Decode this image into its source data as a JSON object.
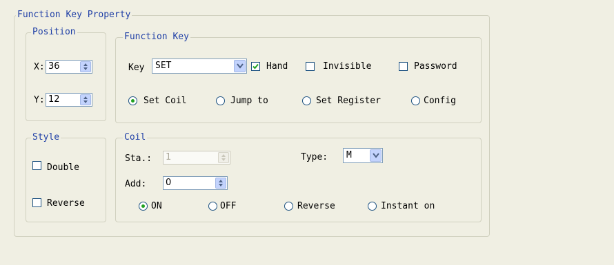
{
  "main_group": {
    "title": "Function Key Property"
  },
  "position": {
    "title": "Position",
    "x_label": "X:",
    "x_value": "36",
    "y_label": "Y:",
    "y_value": "12"
  },
  "function_key": {
    "title": "Function Key",
    "key_label": "Key",
    "key_value": "SET",
    "hand_label": "Hand",
    "hand_checked": true,
    "invisible_label": "Invisible",
    "invisible_checked": false,
    "password_label": "Password",
    "password_checked": false,
    "modes": [
      {
        "label": "Set Coil",
        "selected": true
      },
      {
        "label": "Jump to",
        "selected": false
      },
      {
        "label": "Set Register",
        "selected": false
      },
      {
        "label": "Config",
        "selected": false
      }
    ]
  },
  "style": {
    "title": "Style",
    "double_label": "Double",
    "double_checked": false,
    "reverse_label": "Reverse",
    "reverse_checked": false
  },
  "coil": {
    "title": "Coil",
    "sta_label": "Sta.:",
    "sta_value": "1",
    "type_label": "Type:",
    "type_value": "M",
    "add_label": "Add:",
    "add_value": "0",
    "actions": [
      {
        "label": "ON",
        "selected": true
      },
      {
        "label": "OFF",
        "selected": false
      },
      {
        "label": "Reverse",
        "selected": false
      },
      {
        "label": "Instant on",
        "selected": false
      }
    ]
  },
  "colors": {
    "background": "#f0efe3",
    "group_title": "#1f3fa6",
    "check_mark": "#21a121"
  }
}
